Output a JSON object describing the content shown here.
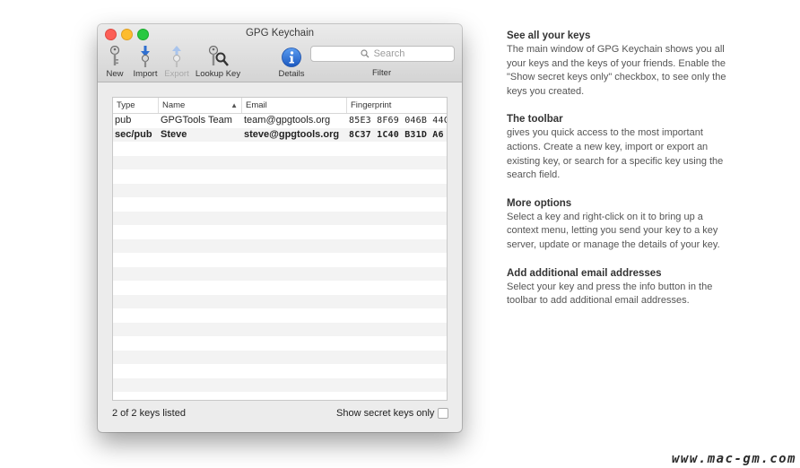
{
  "window": {
    "title": "GPG Keychain"
  },
  "toolbar": {
    "new_label": "New",
    "import_label": "Import",
    "export_label": "Export",
    "lookup_label": "Lookup Key",
    "details_label": "Details",
    "search_placeholder": "Search",
    "filter_label": "Filter",
    "icons": {
      "new": "key-new-icon",
      "import": "key-import-icon",
      "export": "key-export-icon",
      "lookup": "key-lookup-icon",
      "details": "info-icon",
      "search": "search-icon"
    }
  },
  "table": {
    "columns": [
      "Type",
      "Name",
      "Email",
      "Fingerprint"
    ],
    "rows": [
      {
        "type": "pub",
        "name": "GPGTools Team",
        "email": "team@gpgtools.org",
        "fingerprint": "85E3 8F69 046B 44C",
        "bold": false
      },
      {
        "type": "sec/pub",
        "name": "Steve",
        "email": "steve@gpgtools.org",
        "fingerprint": "8C37 1C40 B31D A6",
        "bold": true
      }
    ],
    "empty_rows": 19
  },
  "status": {
    "count_text": "2 of 2 keys listed",
    "secret_label": "Show secret keys only",
    "secret_checked": false
  },
  "notes": [
    {
      "title": "See all your keys",
      "body": "The main window of GPG Keychain shows you all your keys and the keys of your friends. Enable the \"Show secret keys only\" checkbox, to see only the keys you created."
    },
    {
      "title": "The toolbar",
      "body": "gives you quick access to the most important actions. Create a new key, import or export an existing key, or search for a specific key using the search field."
    },
    {
      "title": "More options",
      "body": "Select a key and right-click on it to bring up a context menu, letting you send your key to a key server, update or manage the details of your key."
    },
    {
      "title": "Add additional email addresses",
      "body": "Select your key and press the info button in the toolbar to add additional email addresses."
    }
  ],
  "watermark": "www.mac-gm.com",
  "colors": {
    "close": "#fc5f57",
    "minimize": "#fdbc2e",
    "maximize": "#28c840",
    "info_blue": "#2f6fd0"
  }
}
